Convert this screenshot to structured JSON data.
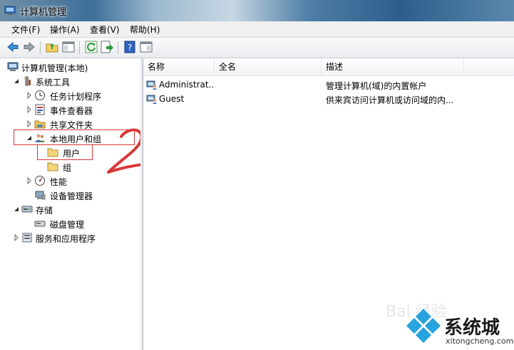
{
  "window": {
    "title": "计算机管理"
  },
  "menu": [
    "文件(F)",
    "操作(A)",
    "查看(V)",
    "帮助(H)"
  ],
  "tree": {
    "root": "计算机管理(本地)",
    "system_tools": "系统工具",
    "task_scheduler": "任务计划程序",
    "event_viewer": "事件查看器",
    "shared_folders": "共享文件夹",
    "local_users_groups": "本地用户和组",
    "users": "用户",
    "groups": "组",
    "performance": "性能",
    "device_manager": "设备管理器",
    "storage": "存储",
    "disk_management": "磁盘管理",
    "services_apps": "服务和应用程序"
  },
  "list": {
    "headers": {
      "name": "名称",
      "full_name": "全名",
      "description": "描述"
    },
    "rows": [
      {
        "name": "Administrat...",
        "full_name": "",
        "description": "管理计算机(域)的内置帐户"
      },
      {
        "name": "Guest",
        "full_name": "",
        "description": "供来宾访问计算机或访问域的内..."
      }
    ]
  },
  "annotation": {
    "text": "2.",
    "color": "#d83838"
  },
  "watermark": {
    "brand": "系统城",
    "url": "xitongcheng.com",
    "faint": "Bai 经验"
  }
}
